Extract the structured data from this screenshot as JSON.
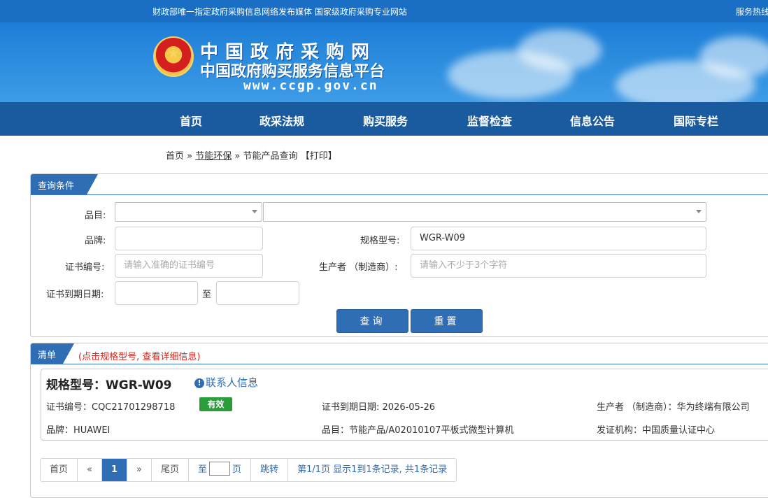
{
  "topbar": {
    "left_text": "财政部唯一指定政府采购信息网络发布媒体 国家级政府采购专业网站",
    "right_text": "服务热线"
  },
  "header": {
    "emblem_icon": "national-emblem-icon",
    "logo_line1": "中国政府采购网",
    "logo_line2": "中国政府购买服务信息平台",
    "logo_url": "www.ccgp.gov.cn"
  },
  "nav": {
    "items": [
      "首页",
      "政采法规",
      "购买服务",
      "监督检查",
      "信息公告",
      "国际专栏"
    ]
  },
  "breadcrumb": {
    "home": "首页",
    "sep1": "»",
    "section": "节能环保",
    "sep2": "»",
    "current": "节能产品查询",
    "print": "【打印】"
  },
  "query": {
    "title": "查询条件",
    "category_label": "品目:",
    "category_value": "",
    "subcategory_value": "",
    "brand_label": "品牌:",
    "brand_value": "",
    "model_label": "规格型号:",
    "model_value": "WGR-W09",
    "cert_label": "证书编号:",
    "cert_placeholder": "请输入准确的证书编号",
    "maker_label": "生产者 （制造商）:",
    "maker_placeholder": "请输入不少于3个字符",
    "expiry_label": "证书到期日期:",
    "expiry_from": "",
    "expiry_sep": "至",
    "expiry_to": "",
    "search_button": "查询",
    "reset_button": "重置"
  },
  "list": {
    "title": "清单",
    "hint": "(点击规格型号, 查看详细信息)"
  },
  "result": {
    "model_title": "规格型号：WGR-W09",
    "contact_icon": "info-circle-icon",
    "contact_label": "联系人信息",
    "cert_no": "证书编号：CQC21701298718",
    "status_badge": "有效",
    "expiry": "证书到期日期: 2026-05-26",
    "maker": "生产者 （制造商）：华为终端有限公司",
    "brand": "品牌：HUAWEI",
    "category": "品目：节能产品/A02010107平板式微型计算机",
    "issuer": "发证机构：中国质量认证中心"
  },
  "pagination": {
    "first": "首页",
    "prev": "«",
    "current_page": "1",
    "next": "»",
    "last": "尾页",
    "goto_prefix": "至",
    "goto_suffix": "页",
    "jump": "跳转",
    "summary": "第1/1页  显示1到1条记录, 共1条记录"
  },
  "colors": {
    "topbar": "#1a6fc4",
    "nav": "#1a5a9e",
    "accent": "#2f6db5",
    "badge_green": "#2a9d3a",
    "hint_red": "#d9261c"
  }
}
